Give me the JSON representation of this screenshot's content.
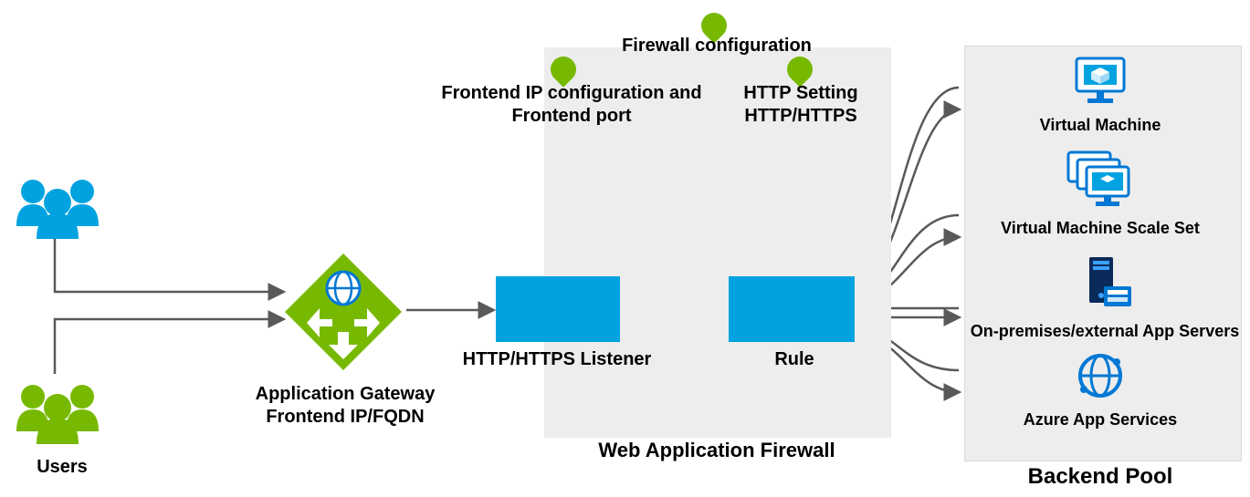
{
  "diagram": {
    "users_label": "Users",
    "appgw_label_line1": "Application Gateway",
    "appgw_label_line2": "Frontend IP/FQDN",
    "waf_title": "Web Application Firewall",
    "firewall_config_label": "Firewall configuration",
    "frontend_ip_label_line1": "Frontend IP configuration and",
    "frontend_ip_label_line2": "Frontend port",
    "http_setting_label_line1": "HTTP Setting",
    "http_setting_label_line2": "HTTP/HTTPS",
    "listener_label": "HTTP/HTTPS Listener",
    "rule_label": "Rule",
    "backend_pool_title": "Backend Pool",
    "backend_items": {
      "vm": "Virtual Machine",
      "vmss": "Virtual Machine Scale Set",
      "onprem": "On-premises/external App Servers",
      "appsvc": "Azure App Services"
    }
  },
  "colors": {
    "azure_blue": "#00a3e0",
    "icon_blue": "#0078d4",
    "leaf_green": "#77b900",
    "arrow_gray": "#595959",
    "panel_gray": "#ededed"
  }
}
